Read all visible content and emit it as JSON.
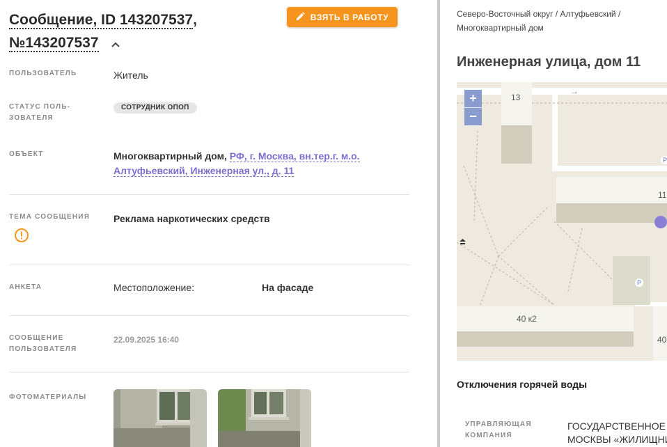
{
  "header": {
    "title_line1": "Сообщение, ID 143207537",
    "title_comma": ",",
    "title_line2": "№143207537",
    "take_button": "ВЗЯТЬ В РАБОТУ"
  },
  "fields": {
    "user_label": "ПОЛЬЗОВАТЕЛЬ",
    "user_value": "Житель",
    "status_label_1": "СТАТУС ПОЛЬ-",
    "status_label_2": "ЗОВАТЕЛЯ",
    "status_value": "СОТРУДНИК ОПОП",
    "object_label": "ОБЪЕКТ",
    "object_type": "Многоквартирный дом, ",
    "object_link_1": "РФ, г. Москва, вн.тер.г. м.о.",
    "object_link_2": "Алтуфьевский, Инженерная ул., д. 11",
    "topic_label": "ТЕМА СООБЩЕНИЯ",
    "topic_value": "Реклама наркотических средств",
    "survey_label": "АНКЕТА",
    "survey_key": "Местоположение:",
    "survey_value": "На фасаде",
    "msg_label_1": "СООБЩЕНИЕ",
    "msg_label_2": "ПОЛЬЗОВАТЕЛЯ",
    "msg_date": "22.09.2025 16:40",
    "photos_label": "ФОТОМАТЕРИАЛЫ"
  },
  "right": {
    "breadcrumb_1": "Северо-Восточный округ / Алтуфьевский /",
    "breadcrumb_2": "Многоквартирный дом",
    "address": "Инженерная улица, дом 11",
    "map": {
      "zoom_in": "+",
      "zoom_out": "−",
      "label_13": "13",
      "label_11": "11",
      "label_40k2": "40 к2",
      "label_40": "40",
      "parking_1": "P",
      "parking_2": "P",
      "arrow": "→"
    },
    "section_title": "Отключения горячей воды",
    "mgmt_label_1": "УПРАВЛЯЮЩАЯ",
    "mgmt_label_2": "КОМПАНИЯ",
    "mgmt_value_1": "ГОСУДАРСТВЕННОЕ Б",
    "mgmt_value_2": "МОСКВЫ «ЖИЛИЩНИ"
  },
  "colors": {
    "accent": "#f7941d",
    "link": "#7b6fd0",
    "map_bg": "#eeeae0",
    "marker": "#8a7fd6"
  },
  "icons": [
    "pencil-icon",
    "chevron-up-icon",
    "warning-icon",
    "plus-icon",
    "minus-icon",
    "parking-icon",
    "location-marker-icon"
  ]
}
